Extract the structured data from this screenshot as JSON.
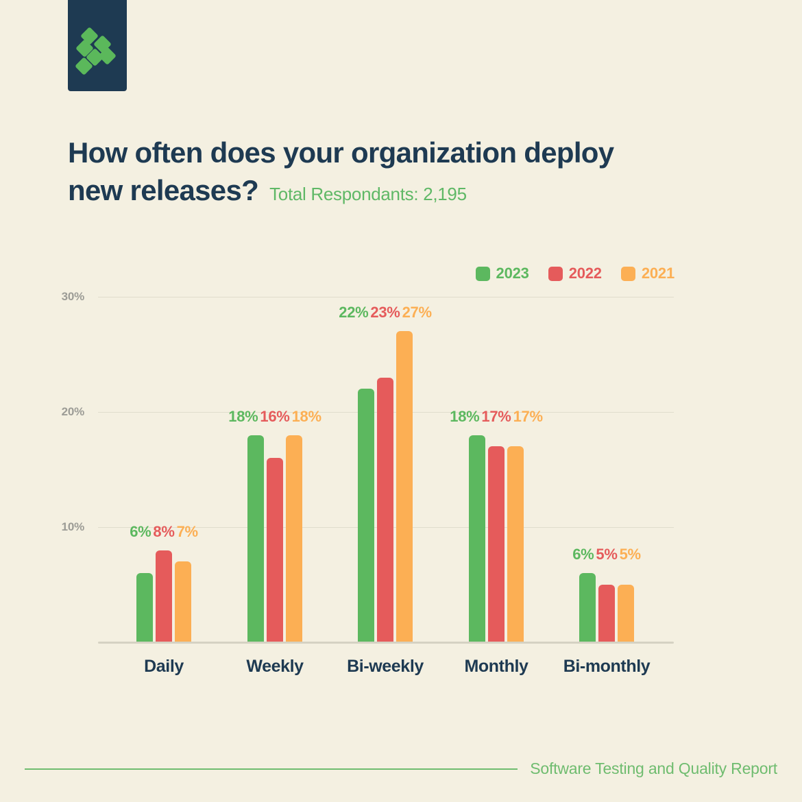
{
  "brand": {
    "logo_name": "logo-mark",
    "logo_bg": "#1e3a52",
    "logo_accent": "#5bb85b"
  },
  "header": {
    "title_line1": "How often does your organization deploy",
    "title_line2": "new releases?",
    "subtitle": "Total Respondants: 2,195",
    "title_color": "#1e3a52",
    "subtitle_color": "#5fb866"
  },
  "footer": {
    "text": "Software Testing and Quality Report",
    "rule_color": "#6fbc6f"
  },
  "chart_data": {
    "type": "bar",
    "title": "How often does your organization deploy new releases?",
    "subtitle": "Total Respondants: 2,195",
    "xlabel": "",
    "ylabel": "",
    "ylim": [
      0,
      30
    ],
    "yticks": [
      "10%",
      "20%",
      "30%"
    ],
    "ytick_values": [
      10,
      20,
      30
    ],
    "grid": true,
    "legend_position": "top-right",
    "categories": [
      "Daily",
      "Weekly",
      "Bi-weekly",
      "Monthly",
      "Bi-monthly"
    ],
    "series": [
      {
        "name": "2023",
        "color": "#5cb85f",
        "values": [
          6,
          18,
          22,
          18,
          6
        ],
        "labels": [
          "6%",
          "18%",
          "22%",
          "18%",
          "6%"
        ]
      },
      {
        "name": "2022",
        "color": "#e55b5b",
        "values": [
          8,
          16,
          23,
          17,
          5
        ],
        "labels": [
          "8%",
          "16%",
          "23%",
          "17%",
          "5%"
        ]
      },
      {
        "name": "2021",
        "color": "#fcaf54",
        "values": [
          7,
          18,
          27,
          17,
          5
        ],
        "labels": [
          "7%",
          "18%",
          "27%",
          "17%",
          "5%"
        ]
      }
    ]
  }
}
